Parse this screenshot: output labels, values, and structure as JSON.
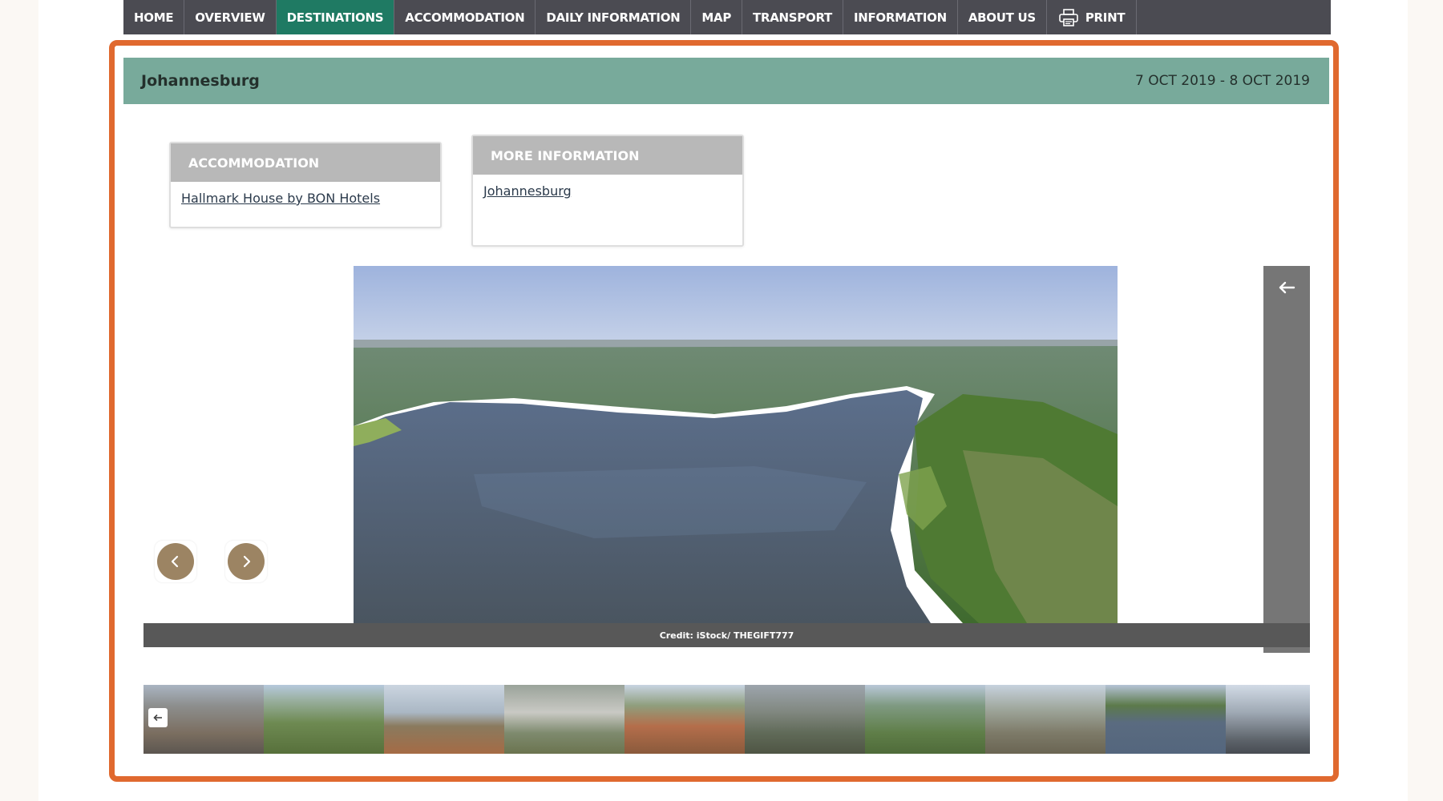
{
  "nav": {
    "items": [
      {
        "label": "HOME"
      },
      {
        "label": "OVERVIEW"
      },
      {
        "label": "DESTINATIONS"
      },
      {
        "label": "ACCOMMODATION"
      },
      {
        "label": "DAILY INFORMATION"
      },
      {
        "label": "MAP"
      },
      {
        "label": "TRANSPORT"
      },
      {
        "label": "INFORMATION"
      },
      {
        "label": "ABOUT US"
      }
    ],
    "active": "DESTINATIONS",
    "print_label": "PRINT"
  },
  "destination": {
    "title": "Johannesburg",
    "dates": "7 OCT 2019 - 8 OCT 2019"
  },
  "accommodation_box": {
    "header": "ACCOMMODATION",
    "link": "Hallmark House by BON Hotels"
  },
  "more_info_box": {
    "header": "MORE INFORMATION",
    "link": "Johannesburg"
  },
  "gallery": {
    "caption": "Credit: iStock/ THEGIFT777",
    "thumbnail_count": 10
  },
  "colors": {
    "nav_bg": "#4b4b52",
    "nav_active": "#1f7a63",
    "header_bg": "#78aa9b",
    "highlight": "#e0692f",
    "box_header": "#b8b8b8",
    "arrow_button": "#9c8463"
  },
  "icons": {
    "print": "printer-icon",
    "prev": "chevron-left-icon",
    "next": "chevron-right-icon",
    "panel": "arrow-left-icon",
    "thumb_back": "arrow-left-icon"
  }
}
